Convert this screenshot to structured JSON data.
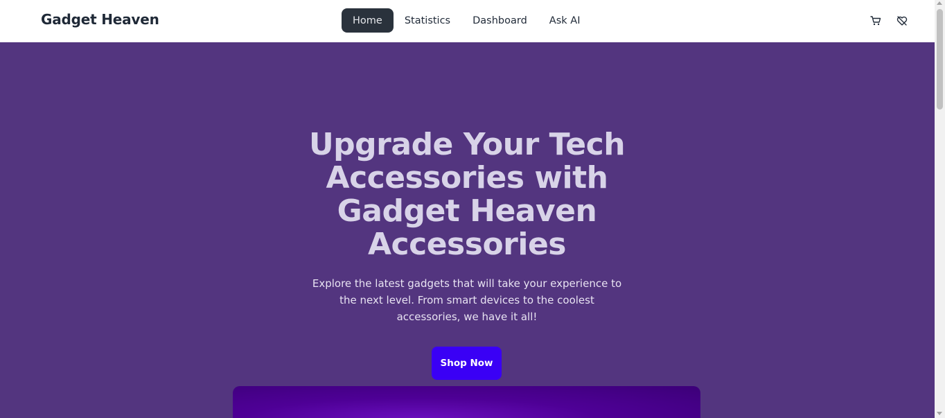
{
  "app": {
    "brand": "Gadget Heaven"
  },
  "nav": {
    "items": [
      {
        "label": "Home",
        "active": true
      },
      {
        "label": "Statistics",
        "active": false
      },
      {
        "label": "Dashboard",
        "active": false
      },
      {
        "label": "Ask AI",
        "active": false
      }
    ],
    "icons": [
      "cart-icon",
      "heart-icon"
    ]
  },
  "hero": {
    "title": "Upgrade Your Tech Accessories with Gadget Heaven Accessories",
    "subtitle": "Explore the latest gadgets that will take your experience to the next level. From smart devices to the coolest accessories, we have it all!",
    "cta_label": "Shop Now"
  },
  "colors": {
    "hero_bg": "#53357f",
    "cta_bg": "#3a00f5",
    "active_nav_bg": "#2a323c",
    "banner": "#4e0096"
  }
}
